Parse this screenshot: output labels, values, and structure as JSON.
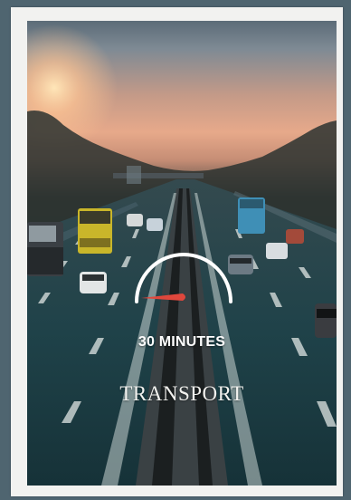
{
  "card": {
    "duration_label": "30 MINUTES",
    "category_label": "TRANSPORT",
    "gauge_icon": "speedometer-icon",
    "colors": {
      "page_background": "#4f6570",
      "card_background": "#f2f2f0",
      "needle": "#e0473c",
      "text": "#ffffff"
    }
  }
}
